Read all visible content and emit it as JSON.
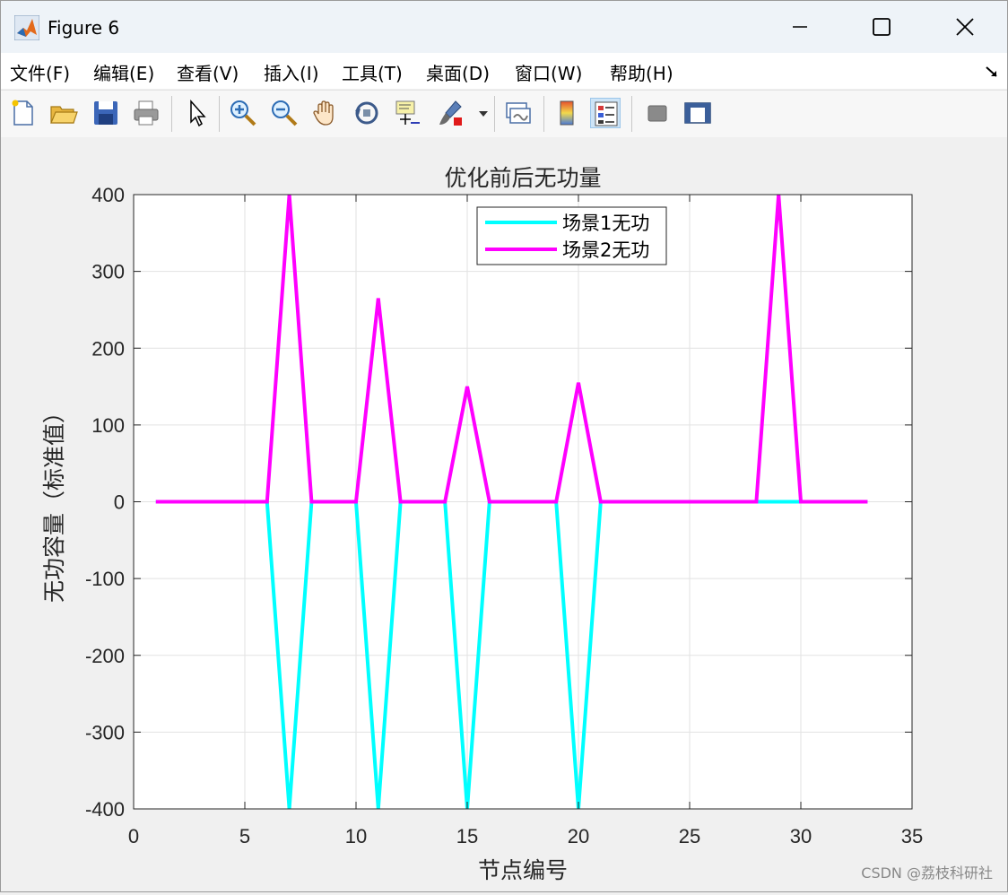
{
  "window": {
    "title": "Figure 6",
    "app_icon": "matlab-logo-icon",
    "controls": [
      "minimize-icon",
      "maximize-icon",
      "close-icon"
    ]
  },
  "menu": {
    "items": [
      "文件(F)",
      "编辑(E)",
      "查看(V)",
      "插入(I)",
      "工具(T)",
      "桌面(D)",
      "窗口(W)",
      "帮助(H)"
    ],
    "dock_icon": "dock-arrow-icon"
  },
  "toolbar": {
    "icons": [
      "new-figure-icon",
      "open-file-icon",
      "save-icon",
      "print-icon",
      "select-pointer-icon",
      "zoom-in-icon",
      "zoom-out-icon",
      "pan-hand-icon",
      "rotate-3d-icon",
      "data-cursor-icon",
      "brush-icon",
      "brush-dropdown-icon",
      "link-plot-icon",
      "colorbar-icon",
      "legend-icon",
      "hide-plot-tools-icon",
      "show-plot-tools-icon"
    ],
    "active": "legend-icon"
  },
  "chart_data": {
    "type": "line",
    "title": "优化前后无功量",
    "xlabel": "节点编号",
    "ylabel": "无功容量（标准值）",
    "xlim": [
      0,
      35
    ],
    "ylim": [
      -400,
      400
    ],
    "xticks": [
      0,
      5,
      10,
      15,
      20,
      25,
      30,
      35
    ],
    "yticks": [
      -400,
      -300,
      -200,
      -100,
      0,
      100,
      200,
      300,
      400
    ],
    "grid": true,
    "legend_position": "top-center",
    "x": [
      1,
      2,
      3,
      4,
      5,
      6,
      7,
      8,
      9,
      10,
      11,
      12,
      13,
      14,
      15,
      16,
      17,
      18,
      19,
      20,
      21,
      22,
      23,
      24,
      25,
      26,
      27,
      28,
      29,
      30,
      31,
      32,
      33
    ],
    "series": [
      {
        "name": "场景1无功",
        "color": "#00ffff",
        "values": [
          0,
          0,
          0,
          0,
          0,
          0,
          -400,
          0,
          0,
          0,
          -400,
          0,
          0,
          0,
          -400,
          0,
          0,
          0,
          0,
          -400,
          0,
          0,
          0,
          0,
          0,
          0,
          0,
          0,
          0,
          0,
          0,
          0,
          0
        ]
      },
      {
        "name": "场景2无功",
        "color": "#ff00ff",
        "values": [
          0,
          0,
          0,
          0,
          0,
          0,
          400,
          0,
          0,
          0,
          265,
          0,
          0,
          0,
          150,
          0,
          0,
          0,
          0,
          155,
          0,
          0,
          0,
          0,
          0,
          0,
          0,
          0,
          400,
          0,
          0,
          0,
          0
        ]
      }
    ]
  },
  "watermark": "CSDN @荔枝科研社"
}
